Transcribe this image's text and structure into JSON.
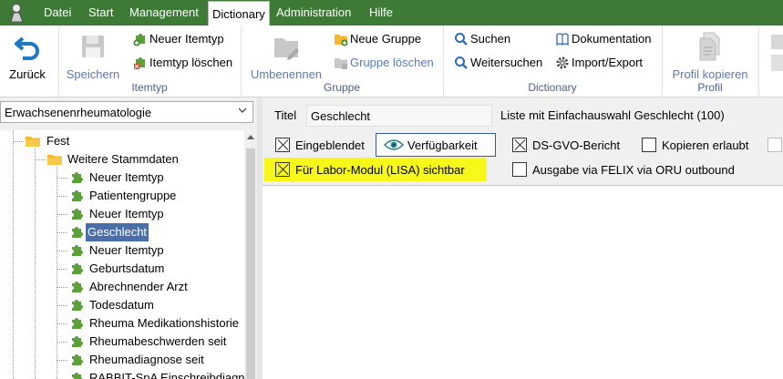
{
  "menu": {
    "items": [
      "Datei",
      "Start",
      "Management",
      "Dictionary",
      "Administration",
      "Hilfe"
    ],
    "active": "Dictionary"
  },
  "ribbon": {
    "back": "Zurück",
    "save": "Speichern",
    "new_itemtype": "Neuer Itemtyp",
    "delete_itemtype": "Itemtyp löschen",
    "group_itemtyp": "Itemtyp",
    "rename": "Umbenennen",
    "new_group": "Neue Gruppe",
    "delete_group": "Gruppe löschen",
    "group_gruppe": "Gruppe",
    "search": "Suchen",
    "search_next": "Weitersuchen",
    "documentation": "Dokumentation",
    "import_export": "Import/Export",
    "group_dictionary": "Dictionary",
    "copy_profile": "Profil kopieren",
    "group_profil": "Profil"
  },
  "left": {
    "combo_value": "Erwachsenenrheumatologie",
    "tree": {
      "root": "Fest",
      "folder": "Weitere Stammdaten",
      "items": [
        "Neuer Itemtyp",
        "Patientengruppe",
        "Neuer Itemtyp",
        "Geschlecht",
        "Neuer Itemtyp",
        "Geburtsdatum",
        "Abrechnender Arzt",
        "Todesdatum",
        "Rheuma Medikationshistorie",
        "Rheumabeschwerden seit",
        "Rheumadiagnose seit",
        "RABBIT-SpA Einschreibdiagnose"
      ],
      "selected_index": 3
    }
  },
  "right": {
    "title_label": "Titel",
    "title_value": "Geschlecht",
    "type_info": "Liste mit Einfachauswahl Geschlecht (100)",
    "checkboxes": {
      "eingeblendet": {
        "label": "Eingeblendet",
        "checked": true
      },
      "dsgvo": {
        "label": "DS-GVO-Bericht",
        "checked": true
      },
      "kopieren": {
        "label": "Kopieren erlaubt",
        "checked": false
      },
      "labor": {
        "label": "Für Labor-Modul (LISA) sichtbar",
        "checked": true
      },
      "felix": {
        "label": "Ausgabe via FELIX via ORU outbound",
        "checked": false
      }
    },
    "visibility_button": "Verfügbarkeit"
  },
  "colors": {
    "menubar": "#3c7a36",
    "highlight": "#f7f71a",
    "selection": "#4a6ea9",
    "group_label": "#4a5f8a"
  }
}
